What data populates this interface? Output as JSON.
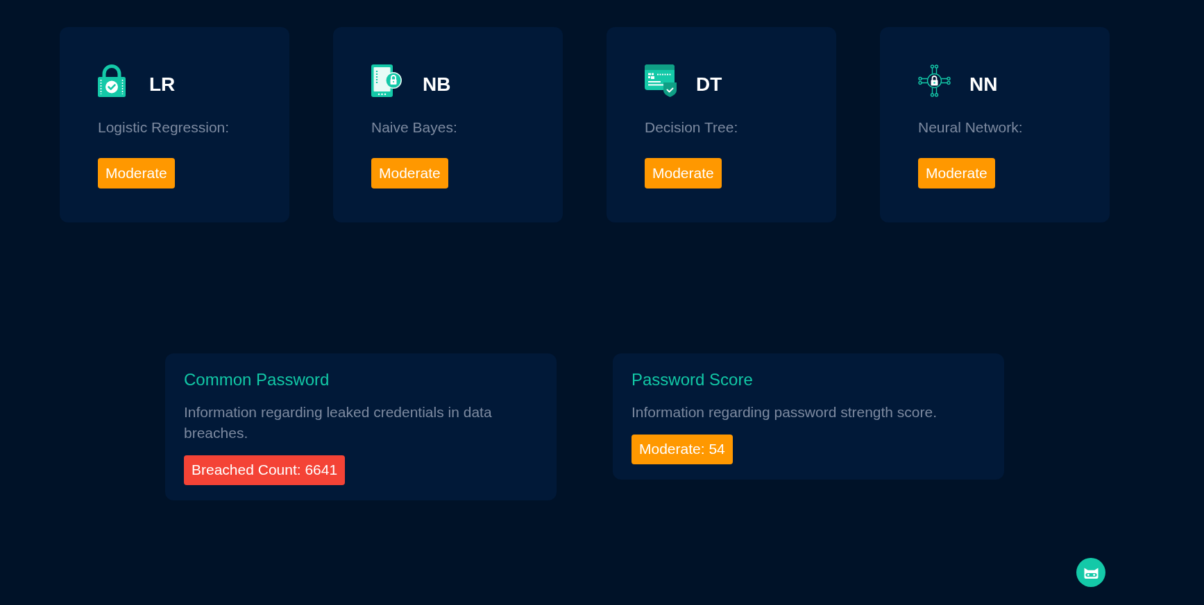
{
  "model_cards": [
    {
      "abbreviation": "LR",
      "name": "Logistic Regression:",
      "badge": {
        "text": "Moderate",
        "color": "#ff9800"
      }
    },
    {
      "abbreviation": "NB",
      "name": "Naive Bayes:",
      "badge": {
        "text": "Moderate",
        "color": "#ff9800"
      }
    },
    {
      "abbreviation": "DT",
      "name": "Decision Tree:",
      "badge": {
        "text": "Moderate",
        "color": "#ff9800"
      }
    },
    {
      "abbreviation": "NN",
      "name": "Neural Network:",
      "badge": {
        "text": "Moderate",
        "color": "#ff9800"
      }
    }
  ],
  "info_cards": [
    {
      "title": "Common Password",
      "description": "Information regarding leaked credentials in data breaches.",
      "badge": {
        "text": "Breached Count: 6641",
        "color": "#f44336"
      }
    },
    {
      "title": "Password Score",
      "description": "Information regarding password strength score.",
      "badge": {
        "text": "Moderate: 54",
        "color": "#ff9800"
      }
    }
  ]
}
